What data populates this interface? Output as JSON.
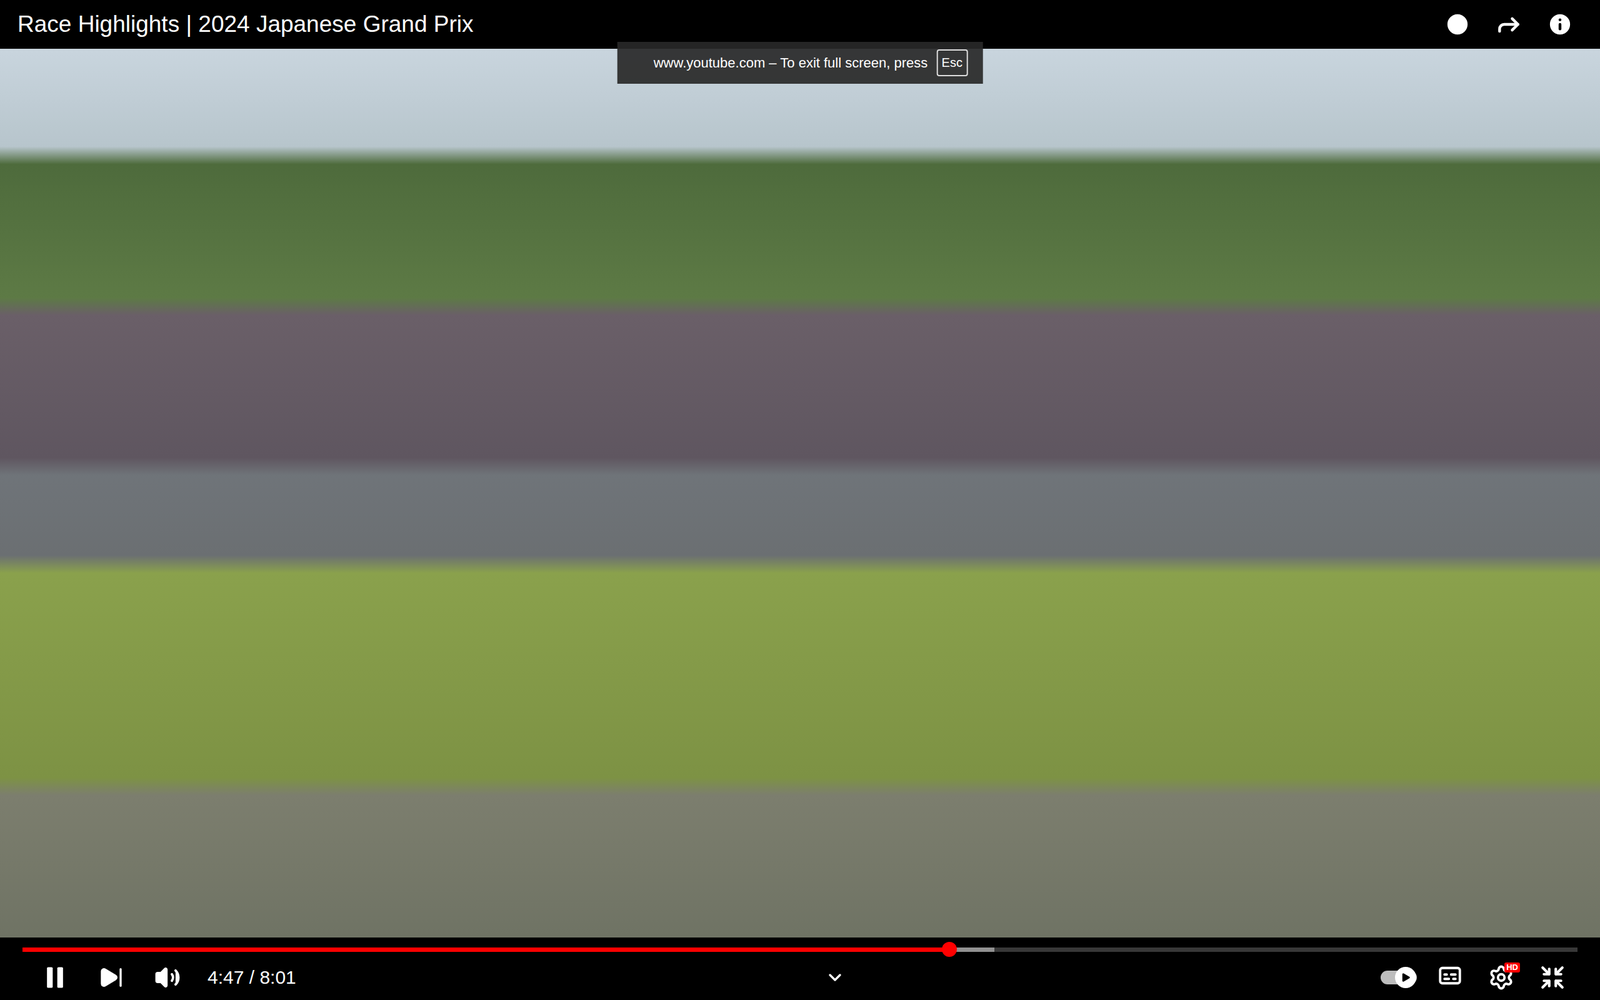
{
  "window": {
    "title": "Race Highlights | 2024 Japanese Grand Prix"
  },
  "fullscreen_notice": {
    "text": "www.youtube.com – To exit full screen, press",
    "key": "Esc"
  },
  "player": {
    "playing": true,
    "time": "4:47 / 8:01",
    "progress": {
      "played": 0.596,
      "buffered": 0.625
    },
    "autoplay": {
      "on": true
    },
    "captions": {
      "on": false
    },
    "settings": {
      "badge": "HD"
    },
    "fullscreen": true
  }
}
